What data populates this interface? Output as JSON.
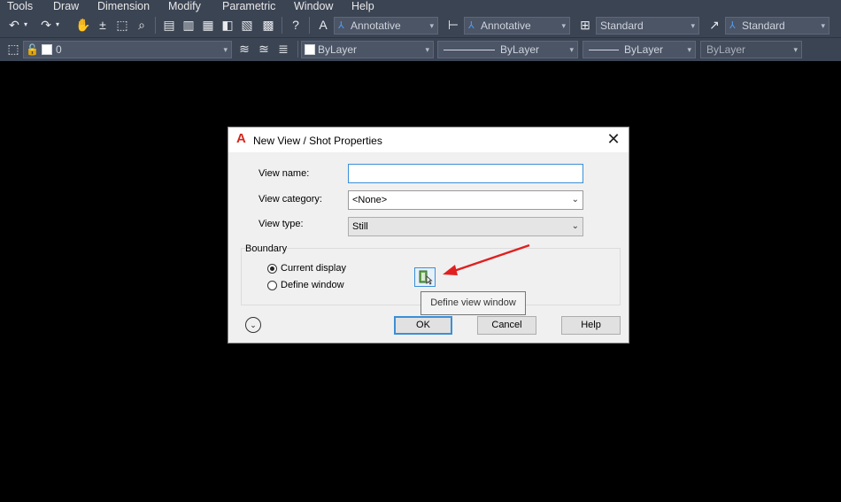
{
  "menubar": {
    "items": [
      "Tools",
      "Draw",
      "Dimension",
      "Modify",
      "Parametric",
      "Window",
      "Help"
    ]
  },
  "toolbar1": {
    "text_style": "Annotative",
    "dim_style": "Annotative",
    "table_style": "Standard",
    "mleader_style": "Standard"
  },
  "toolbar2": {
    "layer": "0",
    "color": "ByLayer",
    "linetype": "ByLayer",
    "lineweight": "ByLayer",
    "plotstyle": "ByLayer"
  },
  "dialog": {
    "title": "New View / Shot Properties",
    "view_name_label": "View name:",
    "view_name_value": "",
    "view_category_label": "View category:",
    "view_category_value": "<None>",
    "view_type_label": "View type:",
    "view_type_value": "Still",
    "boundary_label": "Boundary",
    "current_display_label": "Current display",
    "define_window_label": "Define window",
    "boundary_selected": "Current display",
    "tooltip": "Define view window",
    "ok_label": "OK",
    "cancel_label": "Cancel",
    "help_label": "Help"
  },
  "annotation": {
    "arrow_color": "#e02020"
  }
}
